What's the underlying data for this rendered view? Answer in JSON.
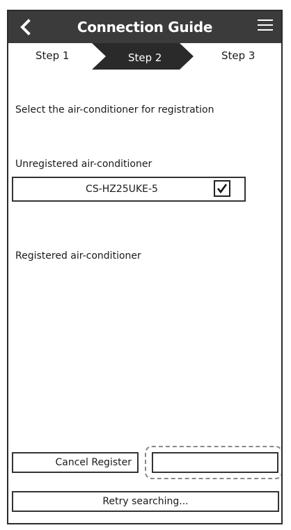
{
  "header": {
    "title": "Connection Guide",
    "back_icon": "chevron-left-icon",
    "menu_icon": "hamburger-menu-icon"
  },
  "steps": {
    "items": [
      {
        "label": "Step 1",
        "active": false
      },
      {
        "label": "Step 2",
        "active": true
      },
      {
        "label": "Step 3",
        "active": false
      }
    ]
  },
  "main": {
    "instruction": "Select the air-conditioner for registration",
    "unregistered_label": "Unregistered air-conditioner",
    "unregistered_items": [
      {
        "model": "CS-HZ25UKE-5",
        "checked": true
      }
    ],
    "registered_label": "Registered air-conditioner"
  },
  "buttons": {
    "cancel_register": "Cancel Register",
    "register": "",
    "retry": "Retry searching..."
  },
  "colors": {
    "header_bg": "#3b3b3b",
    "active_step_bg": "#2a2a2a",
    "highlight_border": "#888888"
  }
}
